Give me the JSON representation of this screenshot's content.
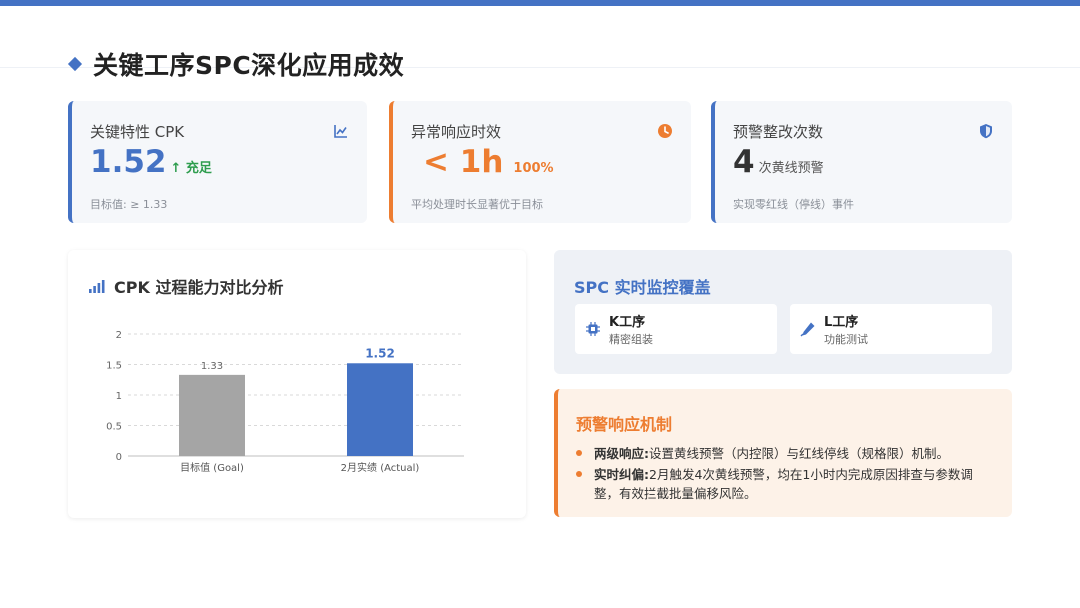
{
  "page": {
    "title": "关键工序SPC深化应用成效"
  },
  "kpis": [
    {
      "label": "关键特性 CPK",
      "value": "1.52",
      "suffix": "↑ 充足",
      "note": "目标值: ≥ 1.33",
      "icon": "line-chart-icon"
    },
    {
      "label": "异常响应时效",
      "value": "< 1h",
      "suffix": "100%",
      "note": "平均处理时长显著优于目标",
      "icon": "clock-icon"
    },
    {
      "label": "预警整改次数",
      "value": "4",
      "suffix": "次黄线预警",
      "note": "实现零红线（停线）事件",
      "icon": "shield-icon"
    }
  ],
  "chart_card": {
    "title": "CPK 过程能力对比分析",
    "icon": "signal-bars-icon"
  },
  "chart_data": {
    "type": "bar",
    "title": "CPK 过程能力对比分析",
    "categories": [
      "目标值 (Goal)",
      "2月实绩 (Actual)"
    ],
    "values": [
      1.33,
      1.52
    ],
    "value_labels": [
      "1.33",
      "1.52"
    ],
    "ylim": [
      0,
      2
    ],
    "yticks": [
      "0",
      "0.5",
      "1",
      "1.5",
      "2"
    ],
    "grid": true,
    "colors": [
      "#a5a5a5",
      "#4472c4"
    ],
    "label_colors": [
      "#666666",
      "#4472c4"
    ]
  },
  "monitor": {
    "title": "SPC 实时监控覆盖",
    "processes": [
      {
        "name": "K工序",
        "desc": "精密组装",
        "icon": "chip-icon"
      },
      {
        "name": "L工序",
        "desc": "功能测试",
        "icon": "probe-icon"
      }
    ]
  },
  "alert": {
    "title": "预警响应机制",
    "items": [
      {
        "head": "两级响应:",
        "text": "设置黄线预警（内控限）与红线停线（规格限）机制。"
      },
      {
        "head": "实时纠偏:",
        "text": "2月触发4次黄线预警，均在1小时内完成原因排查与参数调整，有效拦截批量偏移风险。"
      }
    ]
  },
  "colors": {
    "primary": "#4472c4",
    "accent": "#ed7d31",
    "success": "#2e9d4e",
    "goal_bar": "#a5a5a5"
  }
}
